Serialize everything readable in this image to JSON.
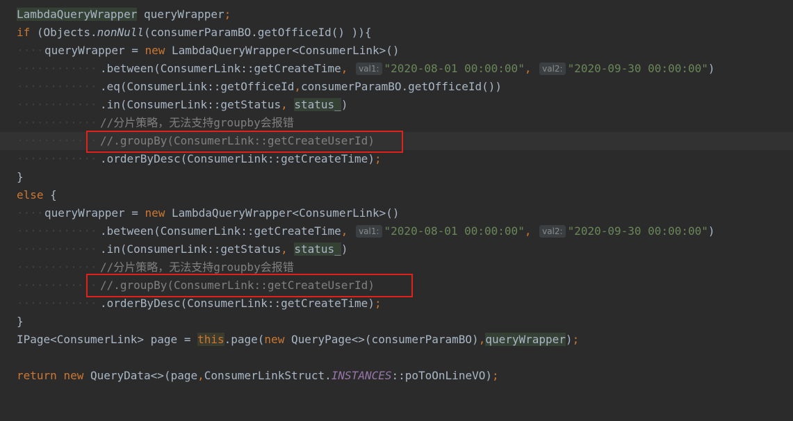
{
  "code": {
    "lines": [
      "LambdaQueryWrapper queryWrapper;",
      "if (Objects.nonNull(consumerParamBO.getOfficeId() )){",
      "queryWrapper = new LambdaQueryWrapper<ConsumerLink>()",
      ".between(ConsumerLink::getCreateTime, \"2020-08-01 00:00:00\", \"2020-09-30 00:00:00\")",
      ".eq(ConsumerLink::getOfficeId,consumerParamBO.getOfficeId())",
      ".in(ConsumerLink::getStatus, status_)",
      "//分片策略，无法支持groupby会报错",
      "//.groupBy(ConsumerLink::getCreateUserId)",
      ".orderByDesc(ConsumerLink::getCreateTime);",
      "}",
      "else {",
      "queryWrapper = new LambdaQueryWrapper<ConsumerLink>()",
      ".between(ConsumerLink::getCreateTime, \"2020-08-01 00:00:00\", \"2020-09-30 00:00:00\")",
      ".in(ConsumerLink::getStatus, status_)",
      "//分片策略，无法支持groupby会报错",
      "//.groupBy(ConsumerLink::getCreateUserId)",
      ".orderByDesc(ConsumerLink::getCreateTime);",
      "}",
      "IPage<ConsumerLink> page = this.page(new QueryPage<>(consumerParamBO),queryWrapper);",
      "",
      "return new QueryData<>(page,ConsumerLinkStruct.INSTANCES::poToOnLineVO);"
    ],
    "hints": {
      "val1": "val1:",
      "val2": "val2:"
    },
    "highlight_box_color": "#e0221b"
  }
}
